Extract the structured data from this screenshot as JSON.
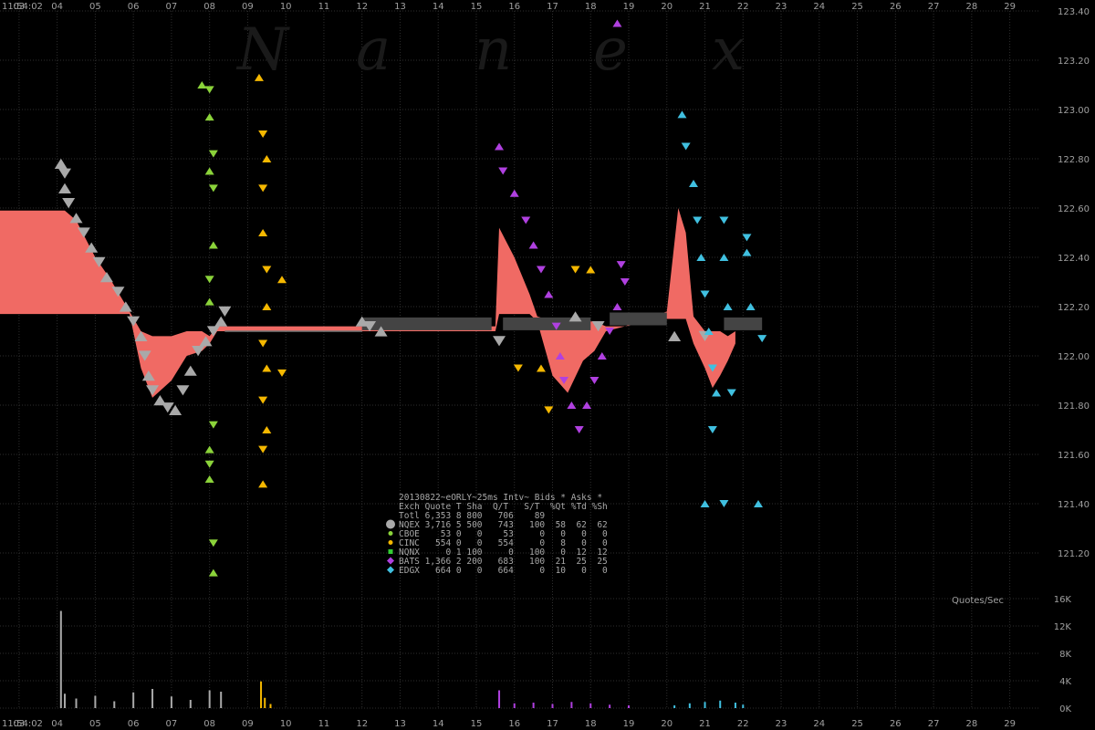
{
  "watermark": [
    "N",
    "a",
    "n",
    "e",
    "x"
  ],
  "time_start_label": "11:54:02",
  "qps_title": "Quotes/Sec",
  "legend": {
    "title": "20130822~eORLY~25ms Intv~ Bids * Asks *",
    "header": "Exch Quote T Sha  Q/T   S/T  %Qt %Td %Sh",
    "rows": [
      {
        "text": "Totl 6,353 8 800   706    89",
        "marker": "none",
        "color": "#000000"
      },
      {
        "text": "NQEX 3,716 5 500   743   100  58  62  62",
        "marker": "circle-large",
        "color": "#a9a9a9"
      },
      {
        "text": "CBOE    53 0   0    53     0   0   0   0",
        "marker": "circle",
        "color": "#8bd33a"
      },
      {
        "text": "CINC   554 0   0   554     0   8   0   0",
        "marker": "circle",
        "color": "#f5b800"
      },
      {
        "text": "NQNX     0 1 100     0   100   0  12  12",
        "marker": "square",
        "color": "#33cc33"
      },
      {
        "text": "BATS 1,366 2 200   683   100  21  25  25",
        "marker": "diamond",
        "color": "#b040e0"
      },
      {
        "text": "EDGX   664 0   0   664     0  10   0   0",
        "marker": "diamond",
        "color": "#40c0e0"
      }
    ]
  },
  "colors": {
    "nbbo_band": "#f06a64",
    "nqex": "#a9a9a9",
    "cboe": "#8bd33a",
    "cinc": "#f5b800",
    "bats": "#b040e0",
    "edgx": "#40c0e0",
    "dark_bar": "#444444",
    "grid": "#2e2e2e"
  },
  "chart_data": [
    {
      "type": "scatter",
      "title": "20130822~eORLY~25ms Intv~ Bids * Asks *",
      "x_tick_labels": [
        "03",
        "04",
        "05",
        "06",
        "07",
        "08",
        "09",
        "10",
        "11",
        "12",
        "13",
        "14",
        "15",
        "16",
        "17",
        "18",
        "19",
        "20",
        "21",
        "22",
        "23",
        "24",
        "25",
        "26",
        "27",
        "28",
        "29"
      ],
      "xlim": [
        2.5,
        29.8
      ],
      "ylim": [
        121.0,
        123.4
      ],
      "y_tick_labels": [
        "121.20",
        "121.40",
        "121.60",
        "121.80",
        "122.00",
        "122.20",
        "122.40",
        "122.60",
        "122.80",
        "123.00",
        "123.20",
        "123.40"
      ],
      "grid": true,
      "nbbo_band": {
        "x": [
          2.5,
          4.2,
          4.5,
          5.0,
          5.4,
          5.9,
          6.2,
          6.5,
          7.0,
          7.4,
          7.8,
          8.0,
          8.2,
          15.5,
          15.6,
          16.0,
          16.4,
          16.6,
          17.0,
          17.4,
          17.8,
          18.1,
          18.4,
          18.9,
          20.0,
          20.3,
          20.5,
          20.7,
          21.0,
          21.2,
          21.4,
          21.6,
          21.8
        ],
        "upper": [
          122.59,
          122.59,
          122.55,
          122.4,
          122.31,
          122.18,
          122.1,
          122.08,
          122.08,
          122.1,
          122.1,
          122.08,
          122.12,
          122.12,
          122.52,
          122.4,
          122.25,
          122.16,
          122.14,
          122.15,
          122.14,
          122.14,
          122.12,
          122.12,
          122.18,
          122.6,
          122.5,
          122.16,
          122.1,
          122.1,
          122.1,
          122.08,
          122.1
        ],
        "lower": [
          122.17,
          122.17,
          122.17,
          122.17,
          122.17,
          122.17,
          121.95,
          121.83,
          121.9,
          122.0,
          122.02,
          122.05,
          122.1,
          122.1,
          122.17,
          122.17,
          122.17,
          122.14,
          121.92,
          121.85,
          121.98,
          122.02,
          122.1,
          122.12,
          122.15,
          122.15,
          122.15,
          122.05,
          121.95,
          121.87,
          121.92,
          121.98,
          122.05
        ]
      },
      "series": [
        {
          "name": "NQEX",
          "points": [
            [
              4.1,
              122.78
            ],
            [
              4.2,
              122.74
            ],
            [
              4.2,
              122.68
            ],
            [
              4.3,
              122.62
            ],
            [
              4.5,
              122.56
            ],
            [
              4.7,
              122.5
            ],
            [
              4.9,
              122.44
            ],
            [
              5.1,
              122.38
            ],
            [
              5.3,
              122.32
            ],
            [
              5.6,
              122.26
            ],
            [
              5.8,
              122.2
            ],
            [
              6.0,
              122.14
            ],
            [
              6.2,
              122.08
            ],
            [
              6.3,
              122.0
            ],
            [
              6.4,
              121.92
            ],
            [
              6.5,
              121.86
            ],
            [
              6.7,
              121.82
            ],
            [
              6.9,
              121.79
            ],
            [
              7.1,
              121.78
            ],
            [
              7.3,
              121.86
            ],
            [
              7.5,
              121.94
            ],
            [
              7.7,
              122.02
            ],
            [
              7.9,
              122.06
            ],
            [
              8.1,
              122.1
            ],
            [
              8.3,
              122.14
            ],
            [
              8.4,
              122.18
            ],
            [
              12.0,
              122.14
            ],
            [
              12.2,
              122.12
            ],
            [
              12.5,
              122.1
            ],
            [
              15.6,
              122.06
            ],
            [
              17.6,
              122.16
            ],
            [
              18.2,
              122.12
            ],
            [
              20.2,
              122.08
            ],
            [
              21.0,
              122.08
            ]
          ]
        },
        {
          "name": "CBOE",
          "points": [
            [
              7.8,
              123.1
            ],
            [
              8.0,
              123.08
            ],
            [
              8.0,
              122.97
            ],
            [
              8.1,
              122.82
            ],
            [
              8.0,
              122.75
            ],
            [
              8.1,
              122.68
            ],
            [
              8.1,
              122.45
            ],
            [
              8.0,
              122.31
            ],
            [
              8.0,
              122.22
            ],
            [
              8.1,
              121.72
            ],
            [
              8.0,
              121.62
            ],
            [
              8.0,
              121.56
            ],
            [
              8.0,
              121.5
            ],
            [
              8.1,
              121.24
            ],
            [
              8.1,
              121.12
            ]
          ]
        },
        {
          "name": "CINC",
          "points": [
            [
              9.3,
              123.13
            ],
            [
              9.4,
              122.9
            ],
            [
              9.5,
              122.8
            ],
            [
              9.4,
              122.68
            ],
            [
              9.4,
              122.5
            ],
            [
              9.5,
              122.35
            ],
            [
              9.5,
              122.2
            ],
            [
              9.4,
              122.05
            ],
            [
              9.5,
              121.95
            ],
            [
              9.4,
              121.82
            ],
            [
              9.5,
              121.7
            ],
            [
              9.4,
              121.62
            ],
            [
              9.9,
              122.31
            ],
            [
              9.9,
              121.93
            ],
            [
              9.4,
              121.48
            ],
            [
              17.6,
              122.35
            ],
            [
              18.0,
              122.35
            ],
            [
              16.1,
              121.95
            ],
            [
              16.7,
              121.95
            ],
            [
              16.9,
              121.78
            ]
          ]
        },
        {
          "name": "BATS",
          "points": [
            [
              15.6,
              122.85
            ],
            [
              15.7,
              122.75
            ],
            [
              16.0,
              122.66
            ],
            [
              16.3,
              122.55
            ],
            [
              16.5,
              122.45
            ],
            [
              16.7,
              122.35
            ],
            [
              16.9,
              122.25
            ],
            [
              17.1,
              122.12
            ],
            [
              17.2,
              122.0
            ],
            [
              17.3,
              121.9
            ],
            [
              17.5,
              121.8
            ],
            [
              17.7,
              121.7
            ],
            [
              17.9,
              121.8
            ],
            [
              18.1,
              121.9
            ],
            [
              18.3,
              122.0
            ],
            [
              18.5,
              122.1
            ],
            [
              18.7,
              122.2
            ],
            [
              18.9,
              122.3
            ],
            [
              18.7,
              123.35
            ],
            [
              18.8,
              122.37
            ]
          ]
        },
        {
          "name": "EDGX",
          "points": [
            [
              20.4,
              122.98
            ],
            [
              20.5,
              122.85
            ],
            [
              20.7,
              122.7
            ],
            [
              20.8,
              122.55
            ],
            [
              20.9,
              122.4
            ],
            [
              21.0,
              122.25
            ],
            [
              21.1,
              122.1
            ],
            [
              21.2,
              121.95
            ],
            [
              21.3,
              121.85
            ],
            [
              21.2,
              121.7
            ],
            [
              21.5,
              122.4
            ],
            [
              21.5,
              122.55
            ],
            [
              21.6,
              122.2
            ],
            [
              21.7,
              121.85
            ],
            [
              22.1,
              122.42
            ],
            [
              22.1,
              122.48
            ],
            [
              22.2,
              122.2
            ],
            [
              22.5,
              122.07
            ],
            [
              21.0,
              121.4
            ],
            [
              21.5,
              121.4
            ],
            [
              22.4,
              121.4
            ]
          ]
        }
      ],
      "dark_bar_segments": [
        [
          12.0,
          15.4,
          122.13
        ],
        [
          15.7,
          18.0,
          122.13
        ],
        [
          18.5,
          20.0,
          122.15
        ],
        [
          21.5,
          22.5,
          122.13
        ]
      ]
    },
    {
      "type": "bar",
      "title": "Quotes/Sec",
      "ylim": [
        0,
        16000
      ],
      "y_tick_labels": [
        "0K",
        "4K",
        "8K",
        "12K",
        "16K"
      ],
      "series": [
        {
          "name": "NQEX",
          "x": [
            4.1,
            4.2,
            4.5,
            5.0,
            5.5,
            6.0,
            6.5,
            7.0,
            7.5,
            8.0,
            8.3
          ],
          "values": [
            14200,
            2100,
            1400,
            1800,
            1000,
            2300,
            2800,
            1700,
            1200,
            2600,
            2400
          ]
        },
        {
          "name": "CINC",
          "x": [
            9.35,
            9.45,
            9.6
          ],
          "values": [
            3900,
            1500,
            600
          ]
        },
        {
          "name": "BATS",
          "x": [
            15.6,
            16.0,
            16.5,
            17.0,
            17.5,
            18.0,
            18.5,
            19.0
          ],
          "values": [
            2600,
            700,
            800,
            600,
            900,
            700,
            500,
            400
          ]
        },
        {
          "name": "EDGX",
          "x": [
            20.2,
            20.6,
            21.0,
            21.4,
            21.8,
            22.0
          ],
          "values": [
            400,
            700,
            900,
            1100,
            800,
            500
          ]
        }
      ]
    }
  ]
}
